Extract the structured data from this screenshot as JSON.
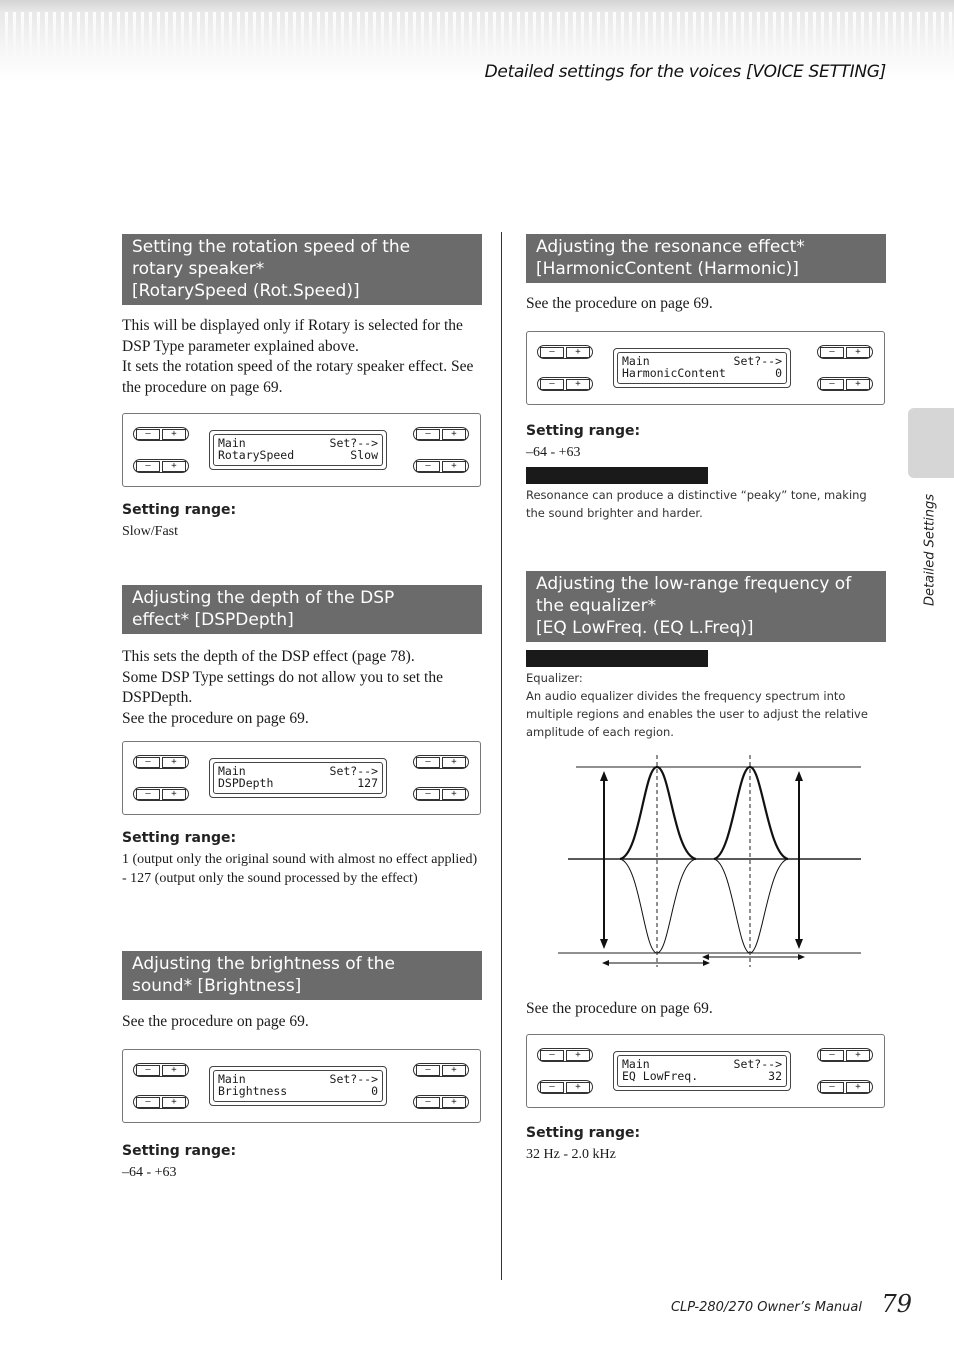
{
  "running_header": "Detailed settings for the voices [VOICE SETTING]",
  "side_tab_label": "Detailed Settings",
  "footer": {
    "manual": "CLP-280/270 Owner’s Manual",
    "page": "79"
  },
  "panel_buttons": {
    "minus": "–",
    "plus": "+"
  },
  "sections": {
    "rotary": {
      "heading": "Setting the rotation speed of the rotary speaker* [RotarySpeed (Rot.Speed)]",
      "heading_lines": [
        "Setting the rotation speed of the",
        "rotary speaker*",
        "[RotarySpeed (Rot.Speed)]"
      ],
      "body": [
        "This will be displayed only if Rotary is selected for the DSP Type parameter explained above.",
        "It sets the rotation speed of the rotary speaker effect. See the procedure on page 69."
      ],
      "lcd": {
        "line1_left": "Main",
        "line1_right": "Set?-->",
        "line2_left": "RotarySpeed",
        "line2_right": "Slow"
      },
      "range_label": "Setting range:",
      "range_value": "Slow/Fast"
    },
    "dspdepth": {
      "heading_lines": [
        "Adjusting the depth of the DSP",
        "effect* [DSPDepth]"
      ],
      "body": [
        "This sets the depth of the DSP effect (page 78).",
        "Some DSP Type settings do not allow you to set the DSPDepth.",
        "See the procedure on page 69."
      ],
      "lcd": {
        "line1_left": "Main",
        "line1_right": "Set?-->",
        "line2_left": "DSPDepth",
        "line2_right": "127"
      },
      "range_label": "Setting range:",
      "range_value": "1 (output only the original sound with almost no effect applied) - 127 (output only the sound processed by the effect)"
    },
    "brightness": {
      "heading_lines": [
        "Adjusting the brightness of the",
        "sound* [Brightness]"
      ],
      "body": [
        "See the procedure on page 69."
      ],
      "lcd": {
        "line1_left": "Main",
        "line1_right": "Set?-->",
        "line2_left": "Brightness",
        "line2_right": "0"
      },
      "range_label": "Setting range:",
      "range_value": "–64 - +63"
    },
    "harmonic": {
      "heading_lines": [
        "Adjusting the resonance effect*",
        "[HarmonicContent (Harmonic)]"
      ],
      "body": [
        "See the procedure on page 69."
      ],
      "lcd": {
        "line1_left": "Main",
        "line1_right": "Set?-->",
        "line2_left": "HarmonicContent",
        "line2_right": "0"
      },
      "range_label": "Setting range:",
      "range_value": "–64 - +63",
      "note": "Resonance can produce a distinctive “peaky” tone, making the sound brighter and harder."
    },
    "eqlow": {
      "heading_lines": [
        "Adjusting the low-range frequency of",
        "the equalizer*",
        "[EQ LowFreq. (EQ L.Freq)]"
      ],
      "note_title": "Equalizer:",
      "note": "An audio equalizer divides the frequency spectrum into multiple regions and enables the user to adjust the relative amplitude of each region.",
      "body": [
        "See the procedure on page 69."
      ],
      "lcd": {
        "line1_left": "Main",
        "line1_right": "Set?-->",
        "line2_left": "EQ LowFreq.",
        "line2_right": "32"
      },
      "range_label": "Setting range:",
      "range_value": "32 Hz - 2.0 kHz"
    }
  }
}
